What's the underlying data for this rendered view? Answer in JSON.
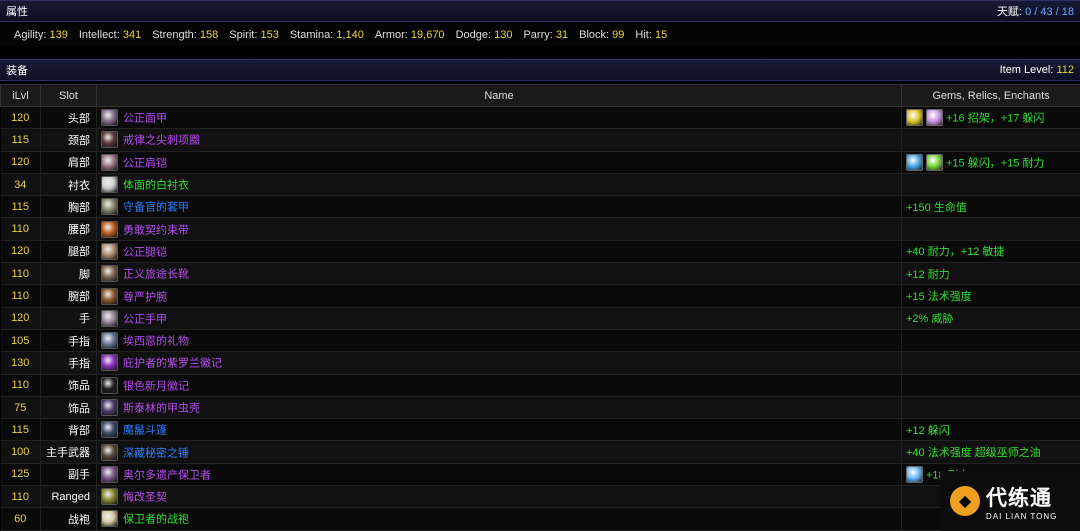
{
  "attributes": {
    "title": "属性",
    "talents_label": "天赋:",
    "talents_value": "0 / 43 / 18",
    "stats": [
      {
        "label": "Agility:",
        "value": "139"
      },
      {
        "label": "Intellect:",
        "value": "341"
      },
      {
        "label": "Strength:",
        "value": "158"
      },
      {
        "label": "Spirit:",
        "value": "153"
      },
      {
        "label": "Stamina:",
        "value": "1,140"
      },
      {
        "label": "Armor:",
        "value": "19,670"
      },
      {
        "label": "Dodge:",
        "value": "130"
      },
      {
        "label": "Parry:",
        "value": "31"
      },
      {
        "label": "Block:",
        "value": "99"
      },
      {
        "label": "Hit:",
        "value": "15"
      }
    ]
  },
  "equipment": {
    "title": "装备",
    "item_level_label": "Item Level:",
    "item_level_value": "112",
    "columns": [
      "iLvl",
      "Slot",
      "Name",
      "Gems, Relics, Enchants"
    ],
    "rows": [
      {
        "ilvl": "120",
        "slot": "头部",
        "name": "公正面甲",
        "quality": "epic",
        "icon_color": "#8a6f8f",
        "gems": [
          "#d8c020",
          "#c890e0"
        ],
        "bonus": "+16 招架，+17 躲闪"
      },
      {
        "ilvl": "115",
        "slot": "颈部",
        "name": "戒律之尖刺项圈",
        "quality": "epic",
        "icon_color": "#5a3a3a",
        "gems": [],
        "bonus": ""
      },
      {
        "ilvl": "120",
        "slot": "肩部",
        "name": "公正肩铠",
        "quality": "epic",
        "icon_color": "#9a7a8a",
        "gems": [
          "#40a0e0",
          "#70d030"
        ],
        "bonus": "+15 躲闪，+15 耐力"
      },
      {
        "ilvl": "34",
        "slot": "衬衣",
        "name": "体面的白衬衣",
        "quality": "uncommon",
        "icon_color": "#cfcfcf",
        "gems": [],
        "bonus": ""
      },
      {
        "ilvl": "115",
        "slot": "胸部",
        "name": "守备官的套甲",
        "quality": "rare",
        "icon_color": "#8a8a6a",
        "gems": [],
        "bonus": "+150 生命值"
      },
      {
        "ilvl": "110",
        "slot": "腰部",
        "name": "勇敢契约束带",
        "quality": "epic",
        "icon_color": "#c06020",
        "gems": [],
        "bonus": ""
      },
      {
        "ilvl": "120",
        "slot": "腿部",
        "name": "公正腿铠",
        "quality": "epic",
        "icon_color": "#b09070",
        "gems": [],
        "bonus": "+40 耐力，+12 敏捷"
      },
      {
        "ilvl": "110",
        "slot": "脚",
        "name": "正义旅途长靴",
        "quality": "epic",
        "icon_color": "#7a6a50",
        "gems": [],
        "bonus": "+12 耐力"
      },
      {
        "ilvl": "110",
        "slot": "腕部",
        "name": "尊严护腕",
        "quality": "epic",
        "icon_color": "#8a5a30",
        "gems": [],
        "bonus": "+15 法术强度"
      },
      {
        "ilvl": "120",
        "slot": "手",
        "name": "公正手甲",
        "quality": "epic",
        "icon_color": "#9a8aa0",
        "gems": [],
        "bonus": "+2% 威胁"
      },
      {
        "ilvl": "105",
        "slot": "手指",
        "name": "埃西恩的礼物",
        "quality": "epic",
        "icon_color": "#6a7a9a",
        "gems": [],
        "bonus": ""
      },
      {
        "ilvl": "130",
        "slot": "手指",
        "name": "庇护者的紫罗兰徽记",
        "quality": "epic",
        "icon_color": "#9030c0",
        "gems": [],
        "bonus": ""
      },
      {
        "ilvl": "110",
        "slot": "饰品",
        "name": "银色新月徽记",
        "quality": "epic",
        "icon_color": "#202020",
        "gems": [],
        "bonus": ""
      },
      {
        "ilvl": "75",
        "slot": "饰品",
        "name": "斯泰林的甲虫壳",
        "quality": "epic",
        "icon_color": "#4a3a6a",
        "gems": [],
        "bonus": ""
      },
      {
        "ilvl": "115",
        "slot": "背部",
        "name": "魔鬣斗篷",
        "quality": "rare",
        "icon_color": "#3a4a6a",
        "gems": [],
        "bonus": "+12 躲闪"
      },
      {
        "ilvl": "100",
        "slot": "主手武器",
        "name": "深藏秘密之锤",
        "quality": "rare",
        "icon_color": "#5a4a3a",
        "gems": [],
        "bonus": "+40 法术强度 超级巫师之油"
      },
      {
        "ilvl": "125",
        "slot": "副手",
        "name": "奥尔多遗产保卫者",
        "quality": "epic",
        "icon_color": "#7a5a8a",
        "gems": [
          "#60b0f0"
        ],
        "bonus": "+18 耐力"
      },
      {
        "ilvl": "110",
        "slot": "Ranged",
        "name": "悔改圣契",
        "quality": "epic",
        "icon_color": "#8a8a30",
        "gems": [],
        "bonus": ""
      },
      {
        "ilvl": "60",
        "slot": "战袍",
        "name": "保卫者的战袍",
        "quality": "uncommon",
        "icon_color": "#d8c8a0",
        "gems": [],
        "bonus": ""
      }
    ]
  },
  "watermark": {
    "cn": "代练通",
    "en": "DAI LIAN TONG"
  }
}
